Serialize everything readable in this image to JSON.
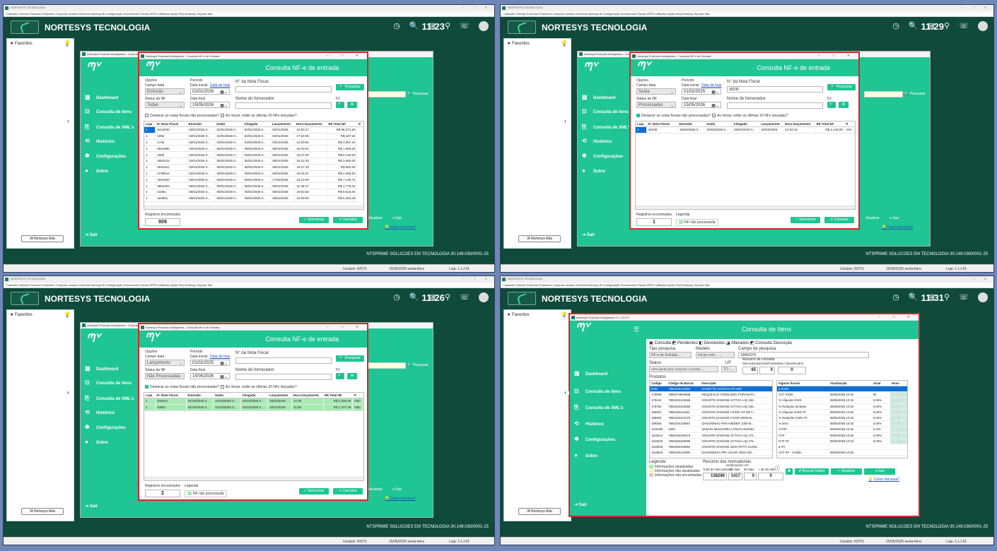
{
  "shell": {
    "menu": "Cadastro  Clientes  Produtos  Financeiro  Compras  Vendas  Gerência  Nortesys BI  Configuração  Documentos Fiscais  SPED  Utilitários  Ajuda  FAQ Nortesys  Suporte  Sair",
    "company": "NORTESYS TECNOLOGIA",
    "favorites": "Favoritos",
    "ia_button": "IA Nortesys Ada",
    "footer_company": "NTSPRIME SOLUCOES EM TECNOLOGIA   30.149.030/0001-25",
    "user": "Usuário: NSYS",
    "date": "15/05/2026 sexta-feira",
    "store": "Loja: 1-LJ-01",
    "win_controls": "─ □ ✕",
    "top_icons": "◷ 🔍 ▤ ⚲ ☏"
  },
  "app": {
    "logo": "ᘉᘁ",
    "nav": [
      "Dashboard",
      "Consulta de itens",
      "Consulta de XML's",
      "Histórico",
      "Configurações",
      "Sobre"
    ],
    "nav_icons": [
      "▥",
      "⊡",
      "⎘",
      "⟲",
      "✱",
      "●"
    ],
    "exit": "Sair",
    "atualizar": "Atualizar",
    "sair_btn": "Sair",
    "como": "Como funciona?",
    "pesquisar": "Pesquisar"
  },
  "consulta_common": {
    "title_bar": "Nortesys Produtos Inteligentes - Consulta NF-e de Entrada",
    "header": "Consulta NF-e de entrada",
    "opcoes": "Opções",
    "campo_data": "Campo data",
    "status_nf": "Status da NF",
    "periodo": "Período",
    "data_inicial": "Data inicial",
    "data_hoje": "Data de hoje",
    "data_final": "Data final",
    "num_nota": "N° da Nota Fiscal",
    "fornecedor": "Nome do fornecedor",
    "f2": "F2",
    "pesquisar": "Pesquisar",
    "chk1": "Destacar as notas fiscais não processadas?",
    "chk2": "Ao iniciar, exibir as últimas 20 NFs lançadas?",
    "registros": "Registros encontrados",
    "legenda": "Legenda",
    "nf_nao_proc": "NF não processada",
    "selecionar": "Selecionar",
    "cancelar": "Cancelar",
    "columns": [
      "Loja",
      "N° Nota Fiscal",
      "Emissão",
      "Saída",
      "Chegada",
      "Lançamento",
      "Hora lançamento",
      "R$ Total NF",
      "P"
    ]
  },
  "q0": {
    "clock": "11:23",
    "campo_data": "Emissão",
    "status": "Todas",
    "data_inicial": "01/01/2026",
    "data_final": "15/05/2026",
    "nota": "",
    "count": "809",
    "rows": [
      [
        "1",
        "3444036",
        "02/01/2026 0...",
        "02/01/2026 0...",
        "02/01/2026 0...",
        "02/01/2026",
        "10:50:17",
        "R$ 86.271,60"
      ],
      [
        "1",
        "1092",
        "02/01/2026 0...",
        "02/01/2026 0...",
        "02/01/2026 0...",
        "02/01/2026",
        "17:25:08",
        "R$ 197,64"
      ],
      [
        "1",
        "1746",
        "02/01/2026 0...",
        "03/01/2026 0...",
        "03/01/2026 0...",
        "03/01/2026",
        "12:00:51",
        "R$ 3.067,20"
      ],
      [
        "1",
        "5842980",
        "02/01/2026 0...",
        "05/01/2026 0...",
        "05/01/2026 0...",
        "05/01/2026",
        "16:33:01",
        "R$ 1.006,00"
      ],
      [
        "1",
        "3260",
        "02/01/2026 0...",
        "05/01/2026 0...",
        "05/01/2026 0...",
        "05/01/2026",
        "16:47:00",
        "R$ 8.140,00"
      ],
      [
        "1",
        "4863123",
        "02/01/2026 0...",
        "05/01/2026 0...",
        "05/01/2026 0...",
        "05/01/2026",
        "18:21:03",
        "R$ 3.690,00"
      ],
      [
        "1",
        "5842941",
        "02/01/2026 0...",
        "05/01/2026 0...",
        "05/01/2026 0...",
        "05/01/2026",
        "16:27:19",
        "R$ 582,30"
      ],
      [
        "1",
        "4738514",
        "02/01/2026 0...",
        "05/01/2026 0...",
        "05/01/2026 0...",
        "05/01/2026",
        "18:32:37",
        "R$ 4.005,00"
      ],
      [
        "1",
        "1921820",
        "02/01/2026 0...",
        "06/01/2026 0...",
        "06/01/2026 0...",
        "17/02/2026",
        "16:13:39",
        "R$ 7.145,72"
      ],
      [
        "1",
        "4881953",
        "05/01/2026 0...",
        "05/01/2026 0...",
        "06/01/2026 0...",
        "06/01/2026",
        "11:49:27",
        "R$ 1.778,44"
      ],
      [
        "1",
        "21084",
        "05/01/2026 0...",
        "05/01/2026 0...",
        "05/01/2026 0...",
        "05/01/2026",
        "19:03:32",
        "R$ 8.615,00"
      ],
      [
        "1",
        "184841",
        "05/01/2026 0...",
        "05/01/2026 0...",
        "05/01/2026 0...",
        "05/01/2026",
        "16:08:00",
        "R$ 6.203,40"
      ]
    ]
  },
  "q1": {
    "clock": "11:29",
    "campo_data": "Saída",
    "status": "Processadas",
    "data_inicial": "01/02/2025",
    "data_final": "15/05/2026",
    "nota": "30230",
    "count": "1",
    "rows": [
      [
        "1",
        "30230",
        "16/02/2026 0...",
        "20/02/2026 0...",
        "20/02/2026 0...",
        "20/02/2026",
        "12:04:10",
        "R$ 2.144,00",
        "Sim"
      ]
    ]
  },
  "q2": {
    "clock": "11:26",
    "campo_data": "Lançamento",
    "status": "Não Processadas",
    "data_inicial": "01/02/2025",
    "data_final": "15/05/2026",
    "nota": "",
    "count": "2",
    "rows": [
      [
        "1",
        "104514",
        "01/10/2025 0...",
        "01/10/2025 0...",
        "03/10/2025 0...",
        "03/10/2025",
        "17:20",
        "R$ 2.200,00",
        "Não"
      ],
      [
        "1",
        "12881",
        "01/10/2025 0...",
        "01/10/2025 0...",
        "03/11/2025 0...",
        "03/11/2025",
        "11:58",
        "R$ 1.377,49",
        "Não"
      ]
    ]
  },
  "q3": {
    "clock": "11:31",
    "title_bar": "Nortesys Produtos Inteligentes © 1.10.0.0",
    "header": "Consulta de Itens",
    "tabs": "▣ Consulta  ◩ Pendentes  ◧ Devolvidos  ◪ Alterados  ◩ Consulta Descrição",
    "tipo_pesquisa": "Tipo pesquisa",
    "tipo_val": "NF-e de Entrada",
    "modelo": "Modelo",
    "modelo_val": "Iniciar com...",
    "campo_pesquisa": "Campo de pesquisa",
    "campo_val": "19401070",
    "status": "Status",
    "status_val": "Ativo geral para compras e vendas",
    "uf": "UF",
    "uf_val": "TO",
    "resumo": "Resumo da consulta",
    "mercadorias": "Mercadorias",
    "classificados": "Classificados",
    "nao_class": "Não Classificados",
    "merc_n": "65",
    "class_n": "0",
    "nao_n": "0",
    "produtos": "Produtos",
    "prod_cols": [
      "Código",
      "Código de Barras",
      "Descrição"
    ],
    "prod_rows": [
      [
        "8284",
        "7891025119459",
        "DANETTE CHOCOLATE 90G"
      ],
      [
        "175009",
        "7896474900668",
        "REQUEIJAO CREM.200G PURANATA..."
      ],
      [
        "175242",
        "7891025102666",
        "IOGURTE DANONE ACTIVIA LIQ 150..."
      ],
      [
        "179782",
        "7891025103096",
        "IOGURTE DANONE ACTIVIA LIQ 150..."
      ],
      [
        "186052",
        "7891025101161",
        "IOGURTE DANONE 170GR VIT DE F..."
      ],
      [
        "188383",
        "7891025101078",
        "IOGURTE DANONE 170GR MORAN..."
      ],
      [
        "199068",
        "7891025109067",
        "DANONINHO PARA BEBER 1000 M..."
      ],
      [
        "1102499",
        "1003",
        "QUEIJO MUSSARELA PIRACANJUBA"
      ],
      [
        "1115616",
        "7891025109419",
        "IOGURTE DANONE ACTIVIA LIQ 170..."
      ],
      [
        "1115320",
        "7891025109396",
        "IOGURTE DANONE ACTIVIA LIQ 170..."
      ],
      [
        "1116048",
        "7891025109891",
        "IOGURTE DANONE 320G PETIT SUISS..."
      ],
      [
        "1118845",
        "7891025110095",
        "DANONINHO PRA LEVAR 200G MO..."
      ]
    ],
    "fig_cols": [
      "Figuras fiscais",
      "Atualização",
      "Atual",
      "Novo"
    ],
    "fig_rows": [
      [
        "● ICMS",
        "",
        "",
        ""
      ],
      [
        "CST ICMS",
        "08/05/2026 10:32",
        "00",
        "-"
      ],
      [
        "% Alíquota ICMS",
        "08/05/2026 10:32",
        "0,00%",
        "-"
      ],
      [
        "% Redução da Base",
        "08/05/2026 10:32",
        "0,00%",
        "-"
      ],
      [
        "% Alíquota ICMS ST",
        "08/05/2026 10:32",
        "0,00%",
        "-"
      ],
      [
        "% Redução ICMS ST",
        "08/05/2026 10:32",
        "0,00%",
        "-"
      ],
      [
        "% MVA",
        "08/05/2026 10:32",
        "0,00%",
        "-"
      ],
      [
        "CFOP",
        "08/05/2026 10:32",
        "6.102",
        "-"
      ],
      [
        "FCP",
        "08/05/2026 10:32",
        "0,00%",
        "-"
      ],
      [
        "FCP ST",
        "08/05/2026 10:32",
        "0,00%",
        "-"
      ],
      [
        "● IPI",
        "",
        "",
        ""
      ],
      [
        "CST IPI - Crédito",
        "08/05/2026 10:32",
        "",
        ""
      ]
    ],
    "legenda": "Legenda",
    "leg1": "Informações atualizadas",
    "leg2": "Informações não atualizadas",
    "leg3": "Informações não encontradas",
    "resumo_merc": "Resumo das mercadorias",
    "total_merc": "Total de Mercadorias",
    "atual_em": "Atualizações em",
    "d30": "30 dias",
    "d60": "60 dias",
    "d60p": "+ de 60 dias",
    "total_n": "138286",
    "n30": "1417",
    "n60": "0",
    "n60p": "0",
    "buscar": "Buscar Dados",
    "atualizar": "Atualizar",
    "sair": "Sair",
    "como": "Como funciona?"
  }
}
